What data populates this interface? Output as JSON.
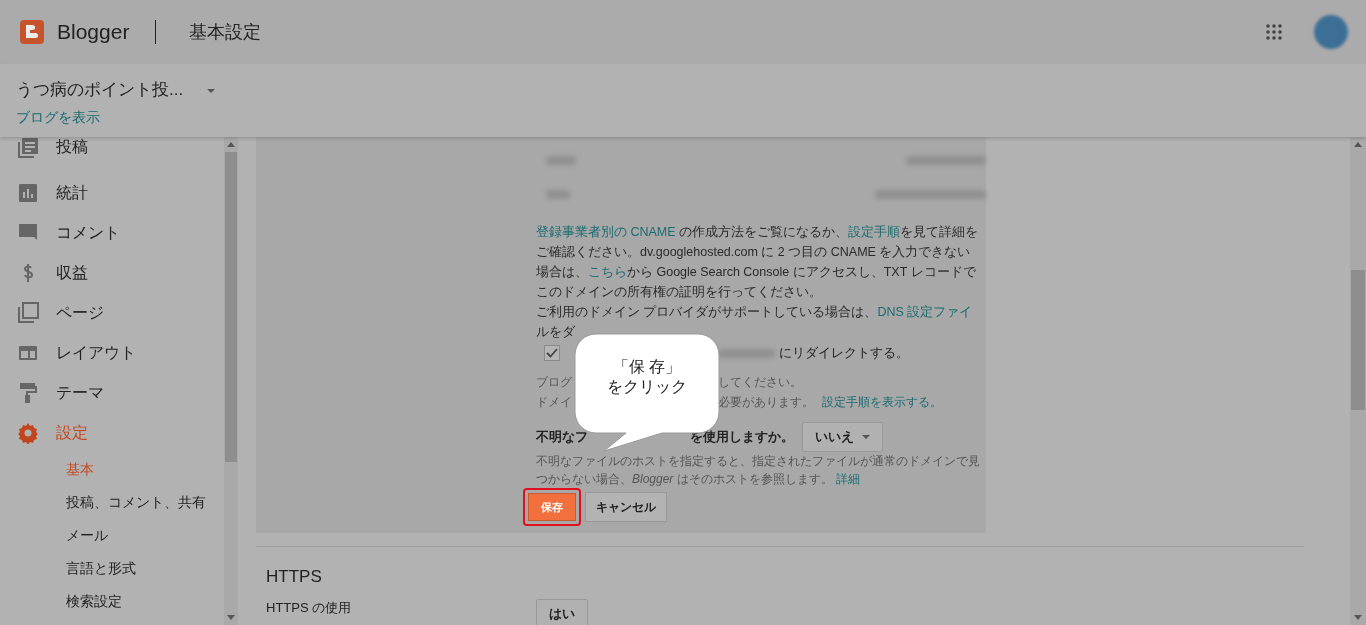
{
  "header": {
    "logo_text": "Blogger",
    "page_title": "基本設定"
  },
  "blog": {
    "name": "うつ病のポイント投...",
    "view_link": "ブログを表示"
  },
  "nav": [
    {
      "label": "投稿",
      "selected": false
    },
    {
      "label": "統計",
      "selected": false
    },
    {
      "label": "コメント",
      "selected": false
    },
    {
      "label": "収益",
      "selected": false
    },
    {
      "label": "ページ",
      "selected": false
    },
    {
      "label": "レイアウト",
      "selected": false
    },
    {
      "label": "テーマ",
      "selected": false
    },
    {
      "label": "設定",
      "selected": true,
      "children": [
        {
          "label": "基本",
          "selected": true
        },
        {
          "label": "投稿、コメント、共有",
          "selected": false
        },
        {
          "label": "メール",
          "selected": false
        },
        {
          "label": "言語と形式",
          "selected": false
        },
        {
          "label": "検索設定",
          "selected": false
        }
      ]
    }
  ],
  "help_paragraphs": [
    [
      {
        "kind": "link",
        "text": "登録事業者別の CNAME"
      },
      {
        "kind": "text",
        "text": " の作成方法をご覧になるか、"
      },
      {
        "kind": "link",
        "text": "設定手順"
      },
      {
        "kind": "text",
        "text": "を見て詳細をご確認ください。dv.googlehosted.com に 2 つ目の CNAME を入力できない場合は、"
      },
      {
        "kind": "link",
        "text": "こちら"
      },
      {
        "kind": "text",
        "text": "から Google Search Console にアクセスし、TXT レコードでこのドメインの所有権の証明を行ってください。"
      }
    ],
    [
      {
        "kind": "text",
        "text": "ご利用のドメイン プロバイダがサポートしている場合は、"
      },
      {
        "kind": "link",
        "text": "DNS 設定ファイ"
      }
    ]
  ],
  "download_fragment": "ルをダ",
  "redirect": {
    "checked": true,
    "text": "にリダイレクトする。"
  },
  "notes": [
    {
      "left": "ブログ",
      "right": "してください。"
    },
    {
      "left": "ドメイ",
      "right": "必要があります。",
      "link": "設定手順を表示する。"
    }
  ],
  "fallback_host": {
    "label_start": "不明なフ",
    "label_end": "を使用しますか。",
    "select": "いいえ",
    "description": "不明なファイルのホストを指定すると、指定されたファイルが通常のドメインで見つからない場合、*Blogger* はそのホストを参照します。",
    "detail_link": "詳細"
  },
  "buttons": {
    "save": "保存",
    "cancel": "キャンセル",
    "save_highlighted": true
  },
  "callout": {
    "lines": [
      "「保 存」",
      "をクリック"
    ]
  },
  "https": {
    "heading": "HTTPS",
    "row_label": "HTTPS の使用",
    "select": "はい"
  }
}
